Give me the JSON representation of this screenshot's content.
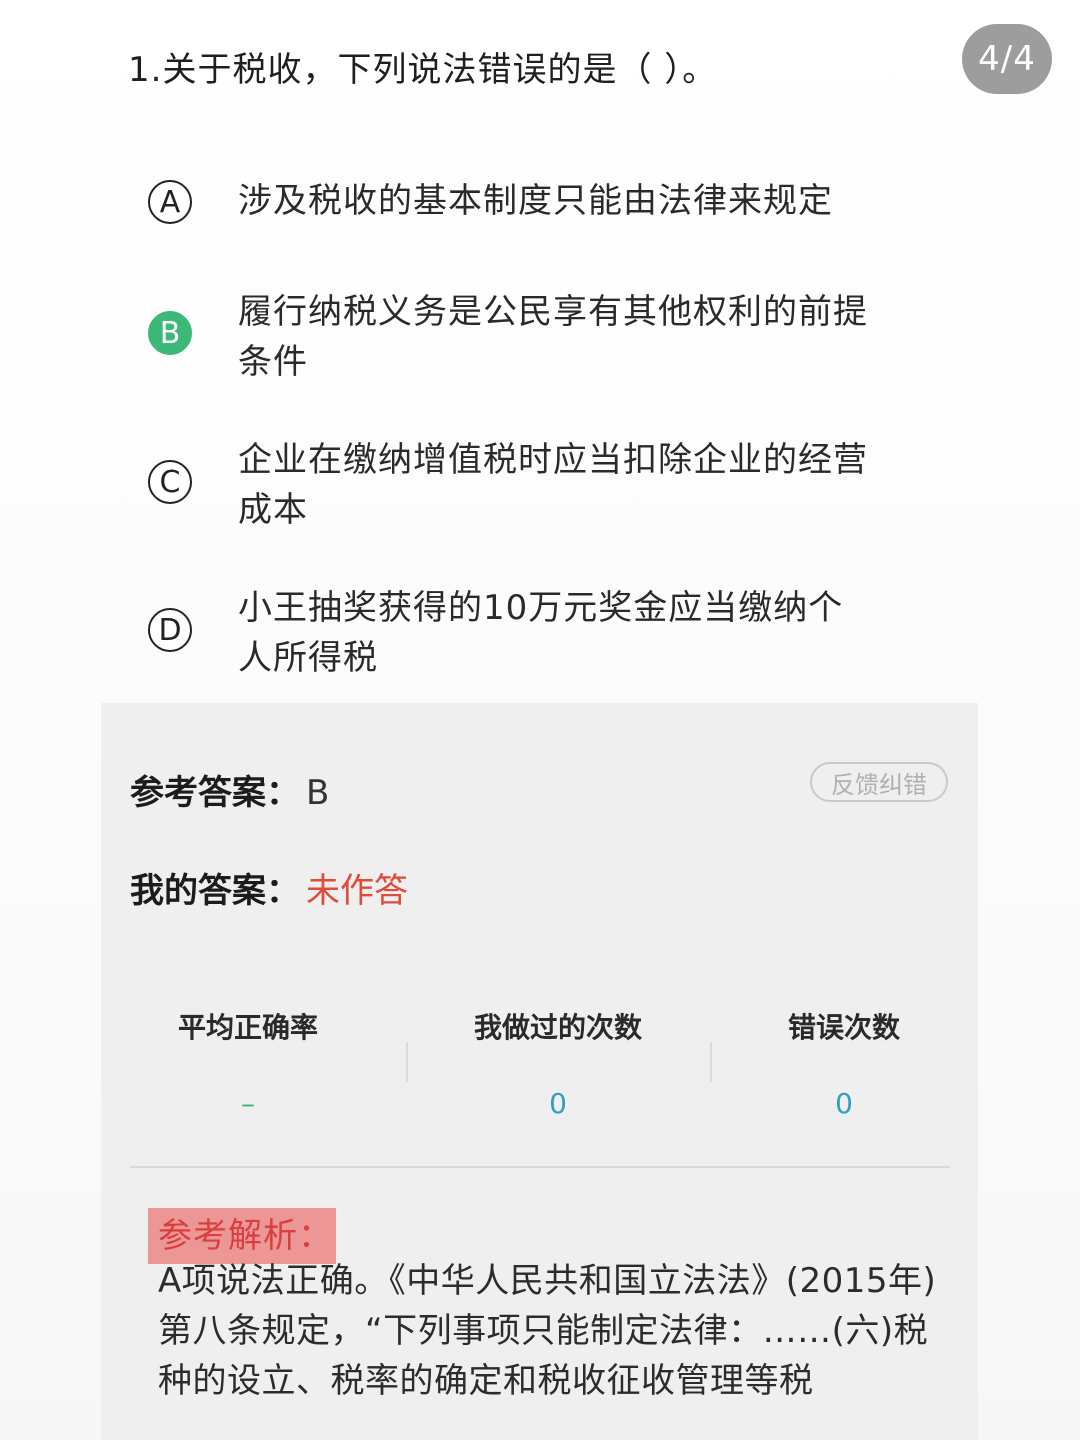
{
  "question": {
    "text": "1.关于税收，下列说法错误的是（   ）。",
    "page_indicator": "4/4"
  },
  "options": [
    {
      "letter": "A",
      "text": "涉及税收的基本制度只能由法律来规定",
      "correct": false
    },
    {
      "letter": "B",
      "text": "履行纳税义务是公民享有其他权利的前提条件",
      "correct": true
    },
    {
      "letter": "C",
      "text": "企业在缴纳增值税时应当扣除企业的经营成本",
      "correct": false
    },
    {
      "letter": "D",
      "text": "小王抽奖获得的10万元奖金应当缴纳个人所得税",
      "correct": false
    }
  ],
  "answer_panel": {
    "ref_label": "参考答案：",
    "ref_value": "B",
    "feedback_button": "反馈纠错",
    "my_label": "我的答案：",
    "my_value": "未作答"
  },
  "stats": [
    {
      "title": "平均正确率",
      "value": "–"
    },
    {
      "title": "我做过的次数",
      "value": "0"
    },
    {
      "title": "错误次数",
      "value": "0"
    }
  ],
  "analysis": {
    "title": "参考解析：",
    "text": "A项说法正确。《中华人民共和国立法法》(2015年)第八条规定，“下列事项只能制定法律：……(六)税种的设立、税率的确定和税收征收管理等税"
  },
  "colors": {
    "correct_green": "#3cb878",
    "unanswered_red": "#e04b3a",
    "stat_blue": "#2f9fc7",
    "badge_gray": "#9d9d9d",
    "highlight_red": "#ec7878"
  }
}
